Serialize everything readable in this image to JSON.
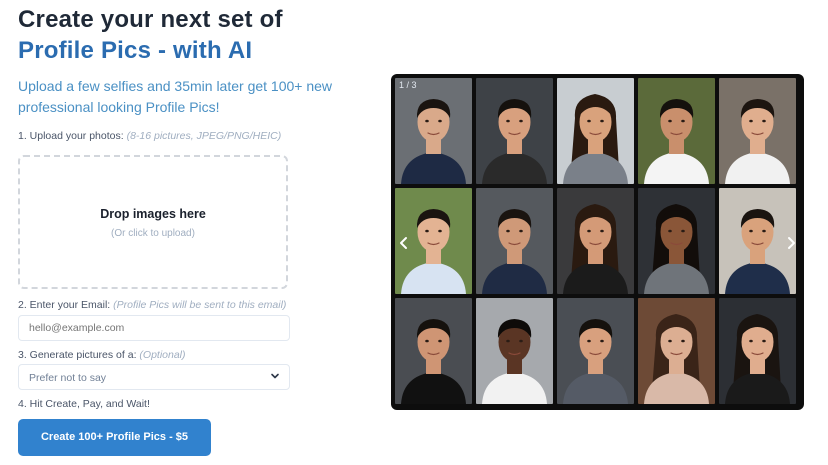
{
  "hero": {
    "title_line1": "Create your next set of",
    "title_line2": "Profile Pics - with AI",
    "subtitle": "Upload a few selfies and 35min later get 100+ new professional looking Profile Pics!"
  },
  "steps": {
    "upload": {
      "label": "1. Upload your photos:",
      "hint": "(8-16 pictures, JPEG/PNG/HEIC)"
    },
    "dropzone": {
      "title": "Drop images here",
      "subtitle": "(Or click to upload)"
    },
    "email": {
      "label": "2. Enter your Email:",
      "hint": "(Profile Pics will be sent to this email)",
      "placeholder": "hello@example.com"
    },
    "gender": {
      "label": "3. Generate pictures of a:",
      "hint": "(Optional)",
      "selected": "Prefer not to say"
    },
    "final": {
      "label": "4. Hit Create, Pay, and Wait!"
    }
  },
  "cta": {
    "label": "Create 100+ Profile Pics - $5"
  },
  "gallery": {
    "counter": "1 / 3",
    "prev_icon": "chevron-left-icon",
    "next_icon": "chevron-right-icon",
    "portraits": [
      {
        "bg": "#6b6f74",
        "skin": "#d9a98a",
        "hair": "#1a1410",
        "shirt": "#1e2a44",
        "long": false
      },
      {
        "bg": "#3e4247",
        "skin": "#d8a07e",
        "hair": "#15110d",
        "shirt": "#2a2a2a",
        "long": false
      },
      {
        "bg": "#c8cdd1",
        "skin": "#d9a27c",
        "hair": "#2a1a10",
        "shirt": "#7a8089",
        "long": true
      },
      {
        "bg": "#5b6a3a",
        "skin": "#c98f6c",
        "hair": "#15110d",
        "shirt": "#f4f4f4",
        "long": false
      },
      {
        "bg": "#7a7168",
        "skin": "#e0ae8e",
        "hair": "#1c1510",
        "shirt": "#f1f1f1",
        "long": false
      },
      {
        "bg": "#6f8a4c",
        "skin": "#e3b393",
        "hair": "#1a1410",
        "shirt": "#d7e3f2",
        "long": false
      },
      {
        "bg": "#55595e",
        "skin": "#cf9978",
        "hair": "#1a1410",
        "shirt": "#1f2b44",
        "long": false
      },
      {
        "bg": "#3a3a3c",
        "skin": "#d49a77",
        "hair": "#2a1a10",
        "shirt": "#1b1b1b",
        "long": true
      },
      {
        "bg": "#2e3136",
        "skin": "#8a5638",
        "hair": "#120d0a",
        "shirt": "#6f747a",
        "long": true
      },
      {
        "bg": "#c7c2ba",
        "skin": "#d9a27c",
        "hair": "#1a1410",
        "shirt": "#1f2e4a",
        "long": false
      },
      {
        "bg": "#4a4d52",
        "skin": "#cf9574",
        "hair": "#15110d",
        "shirt": "#111111",
        "long": false
      },
      {
        "bg": "#a6a9ad",
        "skin": "#5a3524",
        "hair": "#0e0b09",
        "shirt": "#f2f2f2",
        "long": false
      },
      {
        "bg": "#4a4e54",
        "skin": "#d8a07e",
        "hair": "#15110d",
        "shirt": "#555b66",
        "long": false
      },
      {
        "bg": "#6d4a36",
        "skin": "#dcae92",
        "hair": "#3a2418",
        "shirt": "#d9b9a8",
        "long": true
      },
      {
        "bg": "#2c2f34",
        "skin": "#e0ad8e",
        "hair": "#1a1410",
        "shirt": "#1a1a1a",
        "long": true
      }
    ]
  }
}
